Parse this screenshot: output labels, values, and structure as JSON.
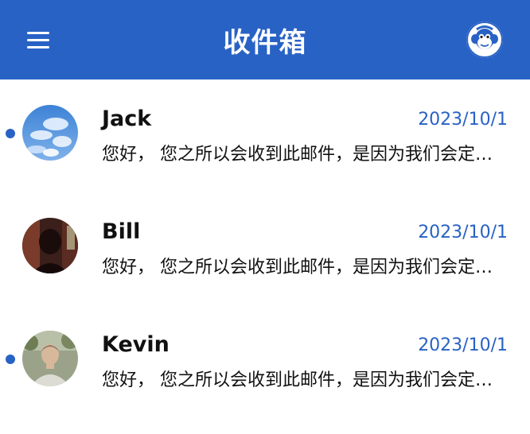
{
  "header": {
    "title": "收件箱",
    "menu_icon": "hamburger-menu-icon",
    "avatar_icon": "monkey-avatar-icon"
  },
  "colors": {
    "primary": "#2962c5",
    "unread_dot": "#2962c5",
    "date_text": "#2962c5",
    "background": "#ffffff"
  },
  "mails": [
    {
      "sender": "Jack",
      "date": "2023/10/1",
      "preview": "您好， 您之所以会收到此邮件，是因为我们会定期向您发送",
      "unread": true,
      "avatar": "sky-clouds-avatar"
    },
    {
      "sender": "Bill",
      "date": "2023/10/1",
      "preview": "您好， 您之所以会收到此邮件，是因为我们会定期向您发送",
      "unread": false,
      "avatar": "silhouette-avatar"
    },
    {
      "sender": "Kevin",
      "date": "2023/10/1",
      "preview": "您好， 您之所以会收到此邮件，是因为我们会定期向您发送",
      "unread": true,
      "avatar": "man-portrait-avatar"
    }
  ]
}
